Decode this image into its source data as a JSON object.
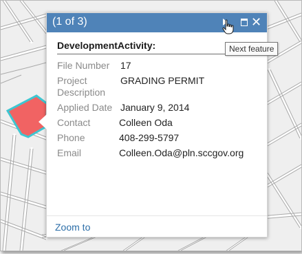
{
  "popup": {
    "count": "(1 of 3)",
    "title": "DevelopmentActivity:",
    "tooltip": "Next feature",
    "zoom_label": "Zoom to",
    "close_glyph": "✕",
    "fields": [
      {
        "label": "File Number",
        "value": "17"
      },
      {
        "label": "Project Description",
        "value": "GRADING PERMIT"
      },
      {
        "label": "Applied Date",
        "value": "January 9, 2014"
      },
      {
        "label": "Contact",
        "value": "Colleen Oda"
      },
      {
        "label": "Phone",
        "value": "408-299-5797"
      },
      {
        "label": "Email",
        "value": "Colleen.Oda@pln.sccgov.org"
      }
    ]
  },
  "icons": {
    "next": "next-feature-icon",
    "maximize": "maximize-icon",
    "close": "close-icon",
    "cursor": "hand-pointer-icon"
  },
  "colors": {
    "header": "#4f83b8",
    "parcel_fill": "#f16363",
    "parcel_outline": "#3ec6d1",
    "link": "#2c6ea8"
  }
}
